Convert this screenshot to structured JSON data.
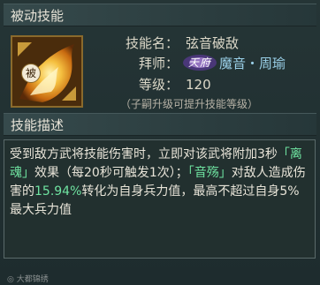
{
  "sections": {
    "passive_skill_title": "被动技能",
    "description_title": "技能描述"
  },
  "skill": {
    "badge": "被",
    "name_label": "技能名：",
    "name_value": "弦音破敌",
    "master_label": "拜师：",
    "master_avatar_text": "天府",
    "master_value": "魔音・周瑜",
    "level_label": "等级：",
    "level_value": "120",
    "hint": "（子嗣升级可提升技能等级）"
  },
  "description": {
    "p1": "受到敌方武将技能伤害时，立即对该武将附加3秒",
    "tag1": "「离魂」",
    "p2": "效果（每20秒可触发1次）；",
    "tag2": "「音殇」",
    "p3": "对敌人造成伤害的",
    "percent": "15.94%",
    "p4": "转化为自身兵力值，最高不超过自身5%最大兵力值"
  },
  "watermark": "大都锦绣",
  "colors": {
    "highlight": "#6fe3a1",
    "icon_flame": "#f0b030"
  }
}
